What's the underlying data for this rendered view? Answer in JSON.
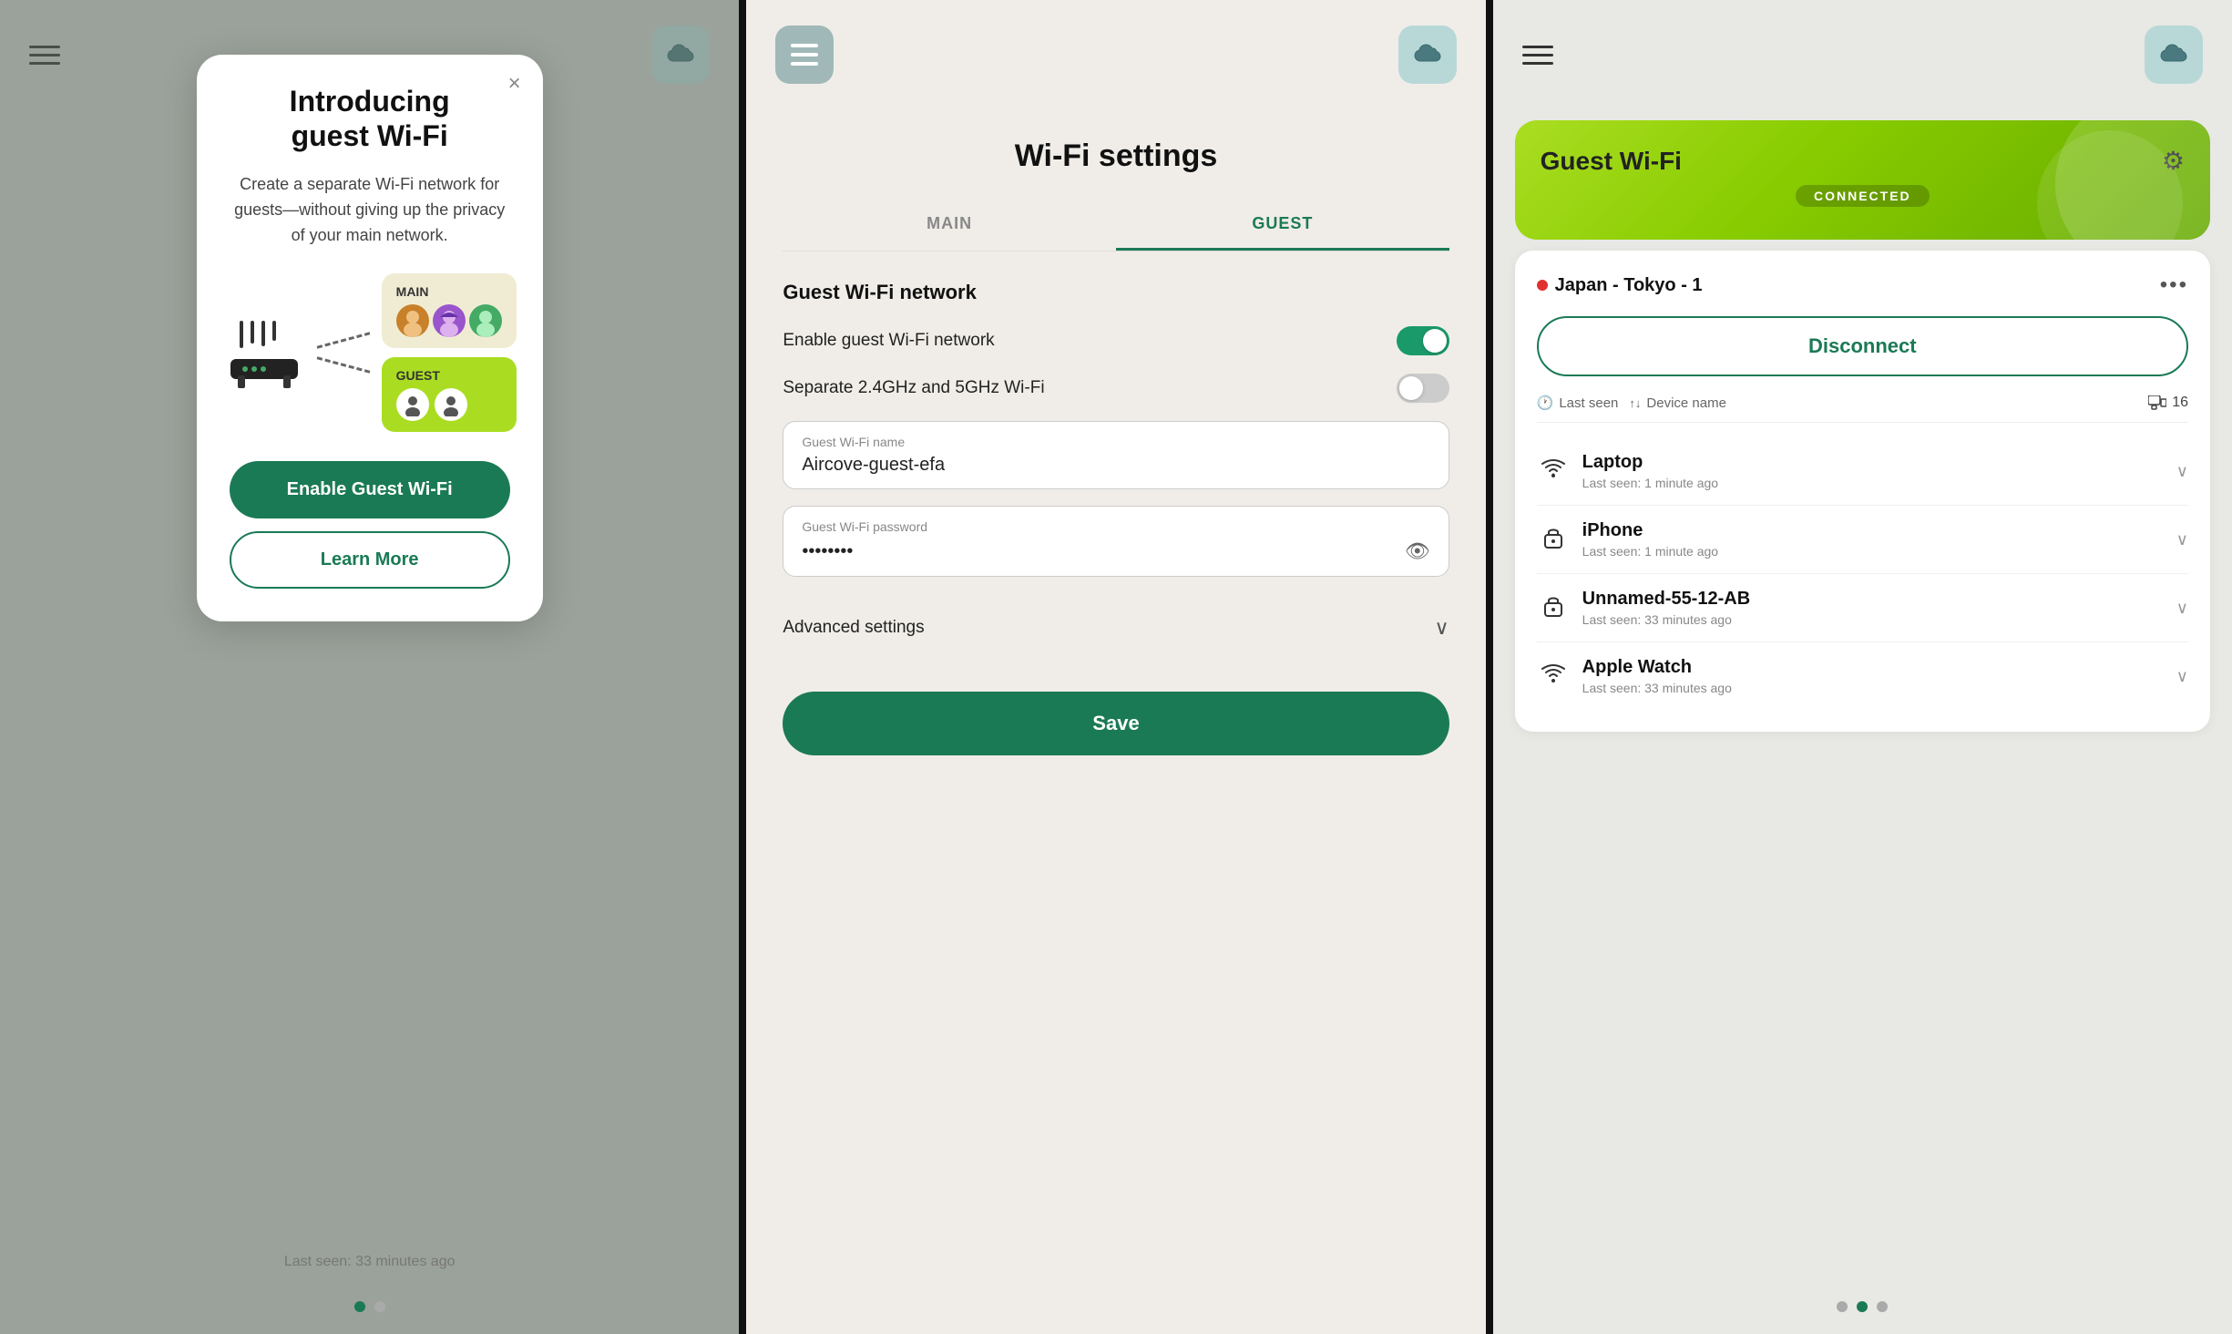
{
  "panel1": {
    "modal": {
      "close_label": "×",
      "title_line1": "Introducing",
      "title_line2": "guest Wi-Fi",
      "description": "Create a separate Wi-Fi network for guests—without giving up the privacy of your main network.",
      "main_label": "MAIN",
      "guest_label": "GUEST",
      "enable_btn": "Enable Guest Wi-Fi",
      "learn_more_btn": "Learn More"
    },
    "bottom_text": "Last seen: 33 minutes ago",
    "dots": [
      true,
      false
    ]
  },
  "panel2": {
    "title": "Wi-Fi settings",
    "tabs": [
      {
        "label": "MAIN",
        "active": false
      },
      {
        "label": "GUEST",
        "active": true
      }
    ],
    "section_title": "Guest Wi-Fi network",
    "toggle1_label": "Enable guest Wi-Fi network",
    "toggle1_on": true,
    "toggle2_label": "Separate 2.4GHz and 5GHz Wi-Fi",
    "toggle2_on": false,
    "wifi_name_label": "Guest Wi-Fi name",
    "wifi_name_value": "Aircove-guest-efa",
    "wifi_password_label": "Guest Wi-Fi password",
    "wifi_password_value": "••••••••",
    "advanced_label": "Advanced settings",
    "save_btn": "Save"
  },
  "panel3": {
    "card_title": "Guest Wi-Fi",
    "connected_label": "CONNECTED",
    "location_name": "Japan - Tokyo - 1",
    "disconnect_btn": "Disconnect",
    "last_seen_label": "Last seen",
    "device_name_label": "Device name",
    "device_count": "16",
    "devices": [
      {
        "name": "Laptop",
        "icon_type": "wifi",
        "last_seen": "Last seen: 1 minute ago"
      },
      {
        "name": "iPhone",
        "icon_type": "lock",
        "last_seen": "Last seen: 1 minute ago"
      },
      {
        "name": "Unnamed-55-12-AB",
        "icon_type": "lock",
        "last_seen": "Last seen: 33 minutes ago"
      },
      {
        "name": "Apple Watch",
        "icon_type": "wifi",
        "last_seen": "Last seen: 33 minutes ago"
      }
    ],
    "dots": [
      false,
      true,
      false
    ]
  }
}
